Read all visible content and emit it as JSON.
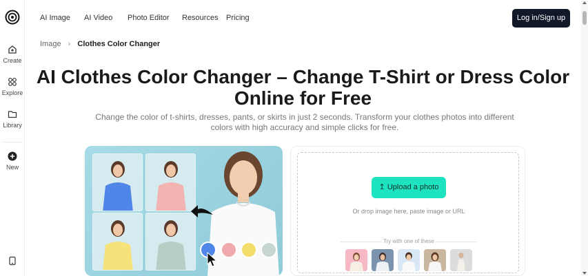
{
  "sidebar": {
    "items": [
      {
        "label": "Create",
        "icon": "create-icon"
      },
      {
        "label": "Explore",
        "icon": "explore-icon"
      },
      {
        "label": "Library",
        "icon": "library-icon"
      },
      {
        "label": "New",
        "icon": "plus-circle-icon"
      }
    ]
  },
  "nav": {
    "items": [
      "AI Image",
      "AI Video",
      "Photo Editor",
      "Resources",
      "Pricing"
    ],
    "login": "Log in/Sign up"
  },
  "breadcrumb": {
    "parent": "Image",
    "separator": "›",
    "current": "Clothes Color Changer"
  },
  "hero": {
    "title": "AI Clothes Color Changer – Change T-Shirt or Dress Color Online for Free",
    "subtitle": "Change the color of t-shirts, dresses, pants, or skirts in just 2 seconds. Transform your clothes photos into different colors with high accuracy and simple clicks for free."
  },
  "showcase": {
    "shirt_colors": [
      "#4f86e8",
      "#f2b3b3",
      "#f5e27a",
      "#b5cfc6"
    ],
    "swatches": [
      "#4f86e8",
      "#f0a9ad",
      "#f4dd6b",
      "#c8d6d0"
    ]
  },
  "upload": {
    "button_label": "Upload a photo",
    "button_icon": "upload-icon",
    "hint": "Or drop image here, paste image or URL",
    "try_label": "Try with one of these"
  },
  "colors": {
    "accent": "#1de3c0",
    "dark": "#111827"
  }
}
